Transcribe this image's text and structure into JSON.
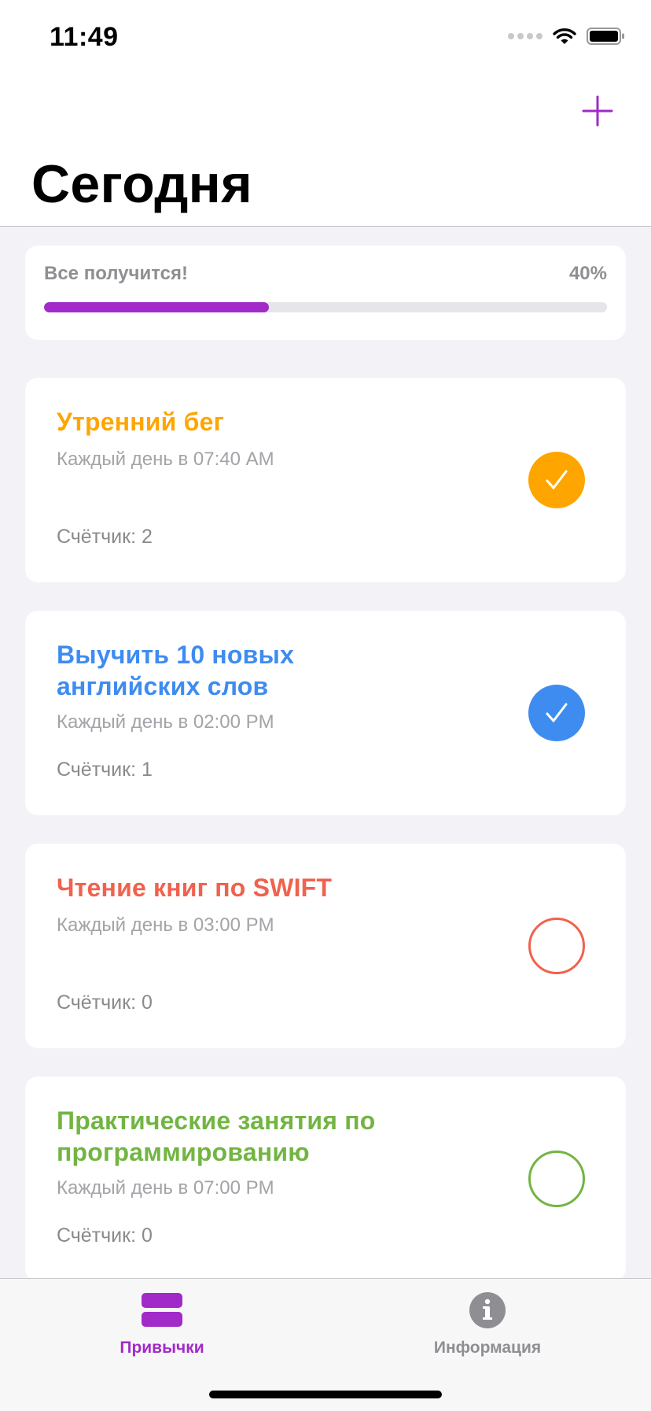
{
  "status_bar": {
    "time": "11:49"
  },
  "header": {
    "title": "Сегодня",
    "add_icon": "plus-icon"
  },
  "progress": {
    "label": "Все получится!",
    "percent_label": "40%",
    "value": 0.4,
    "color": "#a12ac9"
  },
  "habits": [
    {
      "title": "Утренний бег",
      "schedule": "Каждый день в 07:40 AM",
      "counter": "Счётчик: 2",
      "color": "#ffa500",
      "done": true
    },
    {
      "title": "Выучить 10 новых английских слов",
      "schedule": "Каждый день в 02:00 PM",
      "counter": "Счётчик: 1",
      "color": "#3e8cf0",
      "done": true
    },
    {
      "title": "Чтение книг по SWIFT",
      "schedule": "Каждый день в 03:00 PM",
      "counter": "Счётчик: 0",
      "color": "#f0624e",
      "done": false
    },
    {
      "title": "Практические занятия по программированию",
      "schedule": "Каждый день в 07:00 PM",
      "counter": "Счётчик: 0",
      "color": "#72b542",
      "done": false
    }
  ],
  "tabs": [
    {
      "label": "Привычки",
      "icon": "habits-stack-icon",
      "active": true,
      "color": "#a12ac9"
    },
    {
      "label": "Информация",
      "icon": "info-icon",
      "active": false,
      "color": "#8e8e93"
    }
  ]
}
